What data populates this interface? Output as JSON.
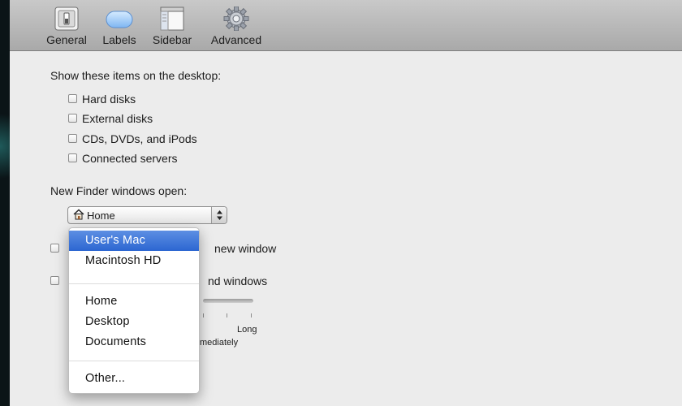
{
  "toolbar": {
    "items": [
      {
        "label": "General",
        "icon": "general-switch-icon"
      },
      {
        "label": "Labels",
        "icon": "labels-icon"
      },
      {
        "label": "Sidebar",
        "icon": "sidebar-icon"
      },
      {
        "label": "Advanced",
        "icon": "gear-icon"
      }
    ]
  },
  "desktop_section": {
    "heading": "Show these items on the desktop:",
    "items": [
      {
        "label": "Hard disks",
        "checked": false
      },
      {
        "label": "External disks",
        "checked": false
      },
      {
        "label": "CDs, DVDs, and iPods",
        "checked": false
      },
      {
        "label": "Connected servers",
        "checked": false
      }
    ]
  },
  "new_window_section": {
    "heading": "New Finder windows open:",
    "selected_value": "Home",
    "selected_icon": "home-icon"
  },
  "option_rows": {
    "row1_visible_text": "new window",
    "row2_visible_text": "nd windows",
    "row2_sub_text": "mediately",
    "slider_end_label": "Long"
  },
  "dropdown_menu": {
    "items": [
      {
        "label": "User's Mac",
        "selected": true
      },
      {
        "label": "Macintosh HD",
        "selected": false
      },
      {
        "label": "Home",
        "selected": false
      },
      {
        "label": "Desktop",
        "selected": false
      },
      {
        "label": "Documents",
        "selected": false
      },
      {
        "label": "Other...",
        "selected": false
      }
    ]
  },
  "colors": {
    "menu_highlight": "#3a72d8",
    "window_bg": "#ececec",
    "toolbar_top": "#c9c9c9"
  }
}
